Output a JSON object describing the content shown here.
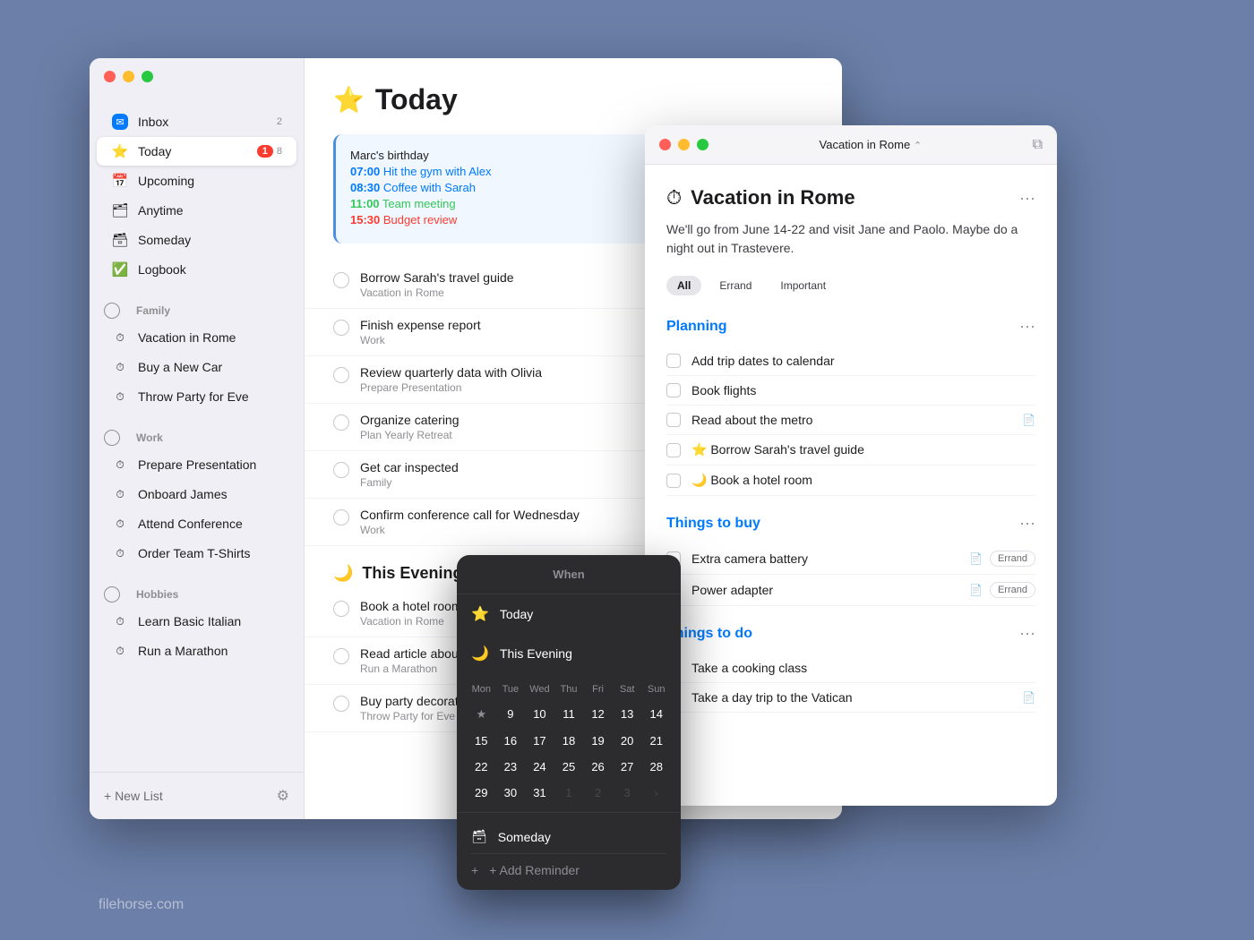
{
  "background_color": "#6b7fa8",
  "watermark": "filehorse.com",
  "main_window": {
    "traffic_lights": [
      "red",
      "yellow",
      "green"
    ],
    "sidebar": {
      "items": [
        {
          "id": "inbox",
          "label": "Inbox",
          "icon": "inbox",
          "badge": "2",
          "active": false
        },
        {
          "id": "today",
          "label": "Today",
          "icon": "star",
          "badge_red": "1",
          "badge_gray": "8",
          "active": true
        },
        {
          "id": "upcoming",
          "label": "Upcoming",
          "icon": "calendar",
          "active": false
        },
        {
          "id": "anytime",
          "label": "Anytime",
          "icon": "layers",
          "active": false
        },
        {
          "id": "someday",
          "label": "Someday",
          "icon": "box",
          "active": false
        },
        {
          "id": "logbook",
          "label": "Logbook",
          "icon": "book",
          "active": false
        }
      ],
      "groups": [
        {
          "name": "Family",
          "items": [
            {
              "label": "Vacation in Rome"
            },
            {
              "label": "Buy a New Car"
            },
            {
              "label": "Throw Party for Eve"
            }
          ]
        },
        {
          "name": "Work",
          "items": [
            {
              "label": "Prepare Presentation"
            },
            {
              "label": "Onboard James"
            },
            {
              "label": "Attend Conference"
            },
            {
              "label": "Order Team T-Shirts"
            }
          ]
        },
        {
          "name": "Hobbies",
          "items": [
            {
              "label": "Learn Basic Italian"
            },
            {
              "label": "Run a Marathon"
            }
          ]
        }
      ],
      "new_list_label": "+ New List"
    },
    "main": {
      "title": "Today",
      "title_icon": "⭐",
      "calendar_strip": {
        "items": [
          {
            "text": "Marc's birthday",
            "time": "",
            "color": "normal"
          },
          {
            "time": "07:00",
            "text": "Hit the gym with Alex",
            "color": "blue"
          },
          {
            "time": "08:30",
            "text": "Coffee with Sarah",
            "color": "blue"
          },
          {
            "time": "11:00",
            "text": "Team meeting",
            "color": "green"
          },
          {
            "time": "15:30",
            "text": "Budget review",
            "color": "red"
          }
        ]
      },
      "tasks": [
        {
          "title": "Borrow Sarah's travel guide",
          "subtitle": "Vacation in Rome"
        },
        {
          "title": "Finish expense report",
          "subtitle": "Work"
        },
        {
          "title": "Review quarterly data with Olivia",
          "subtitle": "Prepare Presentation"
        },
        {
          "title": "Organize catering",
          "subtitle": "Plan Yearly Retreat"
        },
        {
          "title": "Get car inspected",
          "subtitle": "Family"
        },
        {
          "title": "Confirm conference call for Wednesday",
          "subtitle": "Work"
        }
      ],
      "evening_section": "This Evening",
      "evening_icon": "🌙",
      "evening_tasks": [
        {
          "title": "Book a hotel room",
          "subtitle": "Vacation in Rome"
        },
        {
          "title": "Read article about...",
          "subtitle": "Run a Marathon"
        },
        {
          "title": "Buy party decoratio...",
          "subtitle": "Throw Party for Eve"
        }
      ]
    }
  },
  "rome_window": {
    "title": "Vacation in Rome",
    "title_icon": "⏱",
    "project_icon": "⏱",
    "description": "We'll go from June 14-22 and visit Jane and Paolo. Maybe do a night out in Trastevere.",
    "tags": [
      {
        "label": "All",
        "active": true
      },
      {
        "label": "Errand",
        "active": false
      },
      {
        "label": "Important",
        "active": false
      }
    ],
    "sections": [
      {
        "title": "Planning",
        "tasks": [
          {
            "label": "Add trip dates to calendar",
            "icon": null,
            "badge": null
          },
          {
            "label": "Book flights",
            "icon": null,
            "badge": null
          },
          {
            "label": "Read about the metro",
            "icon": "doc",
            "badge": null
          },
          {
            "label": "Borrow Sarah's travel guide",
            "icon": null,
            "badge": null,
            "star": true
          },
          {
            "label": "Book a hotel room",
            "icon": null,
            "badge": null,
            "moon": true
          }
        ]
      },
      {
        "title": "Things to buy",
        "tasks": [
          {
            "label": "Extra camera battery",
            "icon": "doc",
            "badge": "Errand"
          },
          {
            "label": "Power adapter",
            "icon": "doc",
            "badge": "Errand"
          }
        ]
      },
      {
        "title": "Things to do",
        "tasks": [
          {
            "label": "Take a cooking class",
            "icon": null,
            "badge": null
          },
          {
            "label": "Take a day trip to the Vatican",
            "icon": "doc",
            "badge": null
          }
        ]
      }
    ]
  },
  "when_popup": {
    "title": "When",
    "items": [
      {
        "icon": "⭐",
        "label": "Today"
      },
      {
        "icon": "🌙",
        "label": "This Evening"
      }
    ],
    "weekdays": [
      "Mon",
      "Tue",
      "Wed",
      "Thu",
      "Fri",
      "Sat",
      "Sun"
    ],
    "weeks": [
      [
        {
          "d": "★",
          "cls": "star-day"
        },
        {
          "d": "9",
          "cls": ""
        },
        {
          "d": "10",
          "cls": ""
        },
        {
          "d": "11",
          "cls": ""
        },
        {
          "d": "12",
          "cls": ""
        },
        {
          "d": "13",
          "cls": ""
        },
        {
          "d": "14",
          "cls": ""
        }
      ],
      [
        {
          "d": "15",
          "cls": ""
        },
        {
          "d": "16",
          "cls": ""
        },
        {
          "d": "17",
          "cls": ""
        },
        {
          "d": "18",
          "cls": ""
        },
        {
          "d": "19",
          "cls": ""
        },
        {
          "d": "20",
          "cls": ""
        },
        {
          "d": "21",
          "cls": ""
        }
      ],
      [
        {
          "d": "22",
          "cls": ""
        },
        {
          "d": "23",
          "cls": ""
        },
        {
          "d": "24",
          "cls": ""
        },
        {
          "d": "25",
          "cls": ""
        },
        {
          "d": "26",
          "cls": ""
        },
        {
          "d": "27",
          "cls": ""
        },
        {
          "d": "28",
          "cls": ""
        }
      ],
      [
        {
          "d": "29",
          "cls": ""
        },
        {
          "d": "30",
          "cls": ""
        },
        {
          "d": "31",
          "cls": ""
        },
        {
          "d": "1",
          "cls": "next-month"
        },
        {
          "d": "2",
          "cls": "next-month"
        },
        {
          "d": "3",
          "cls": "next-month"
        },
        {
          "d": "›",
          "cls": "next-month"
        }
      ]
    ],
    "footer_items": [
      {
        "icon": "🗓",
        "label": "Someday"
      }
    ],
    "add_reminder": "+ Add Reminder"
  }
}
